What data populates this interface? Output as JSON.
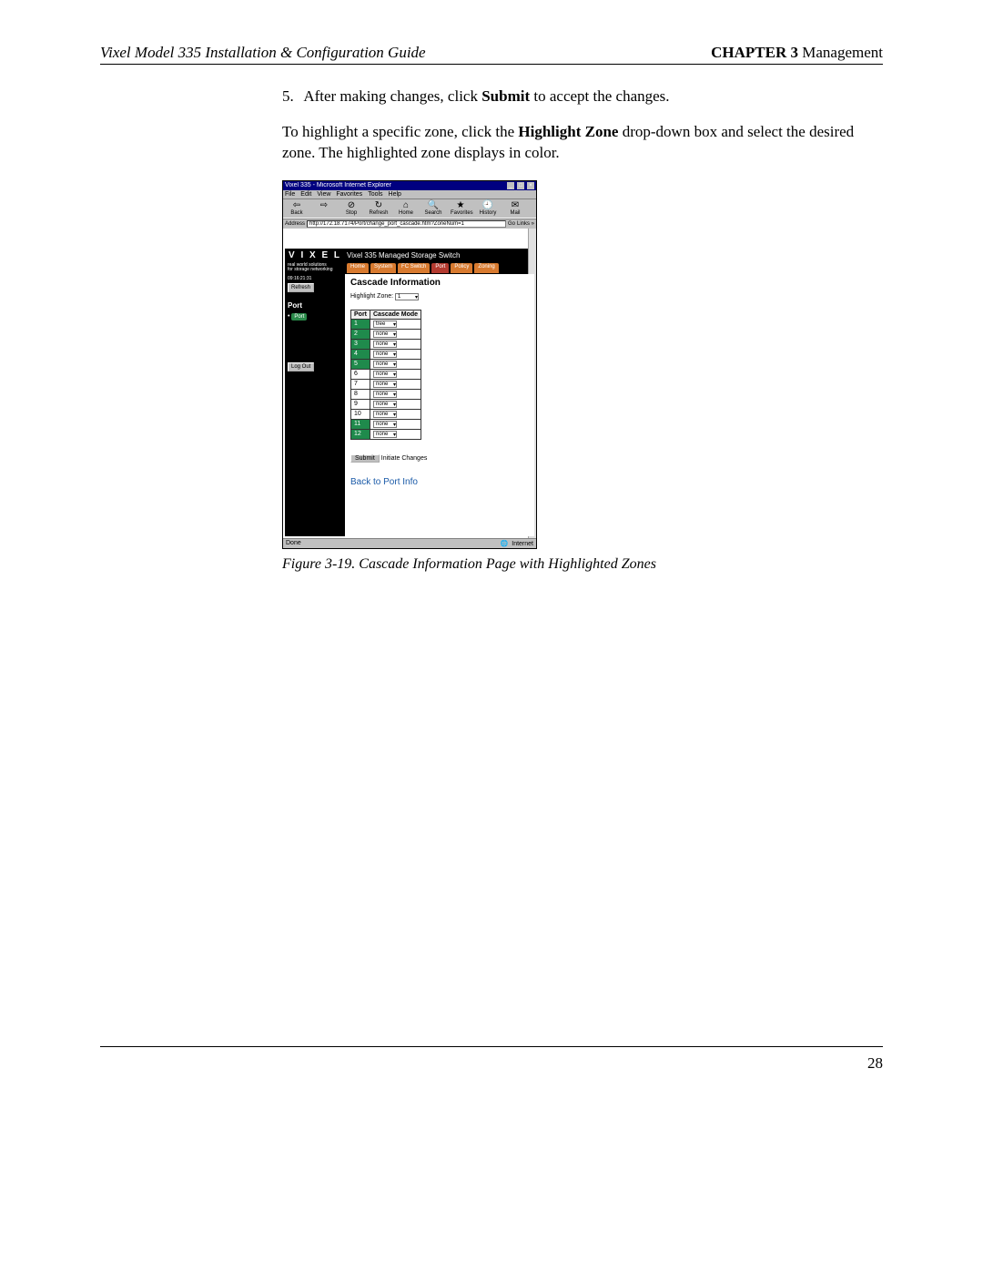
{
  "header": {
    "left": "Vixel Model 335 Installation & Configuration Guide",
    "chapter_label": "CHAPTER 3",
    "chapter_title": " Management"
  },
  "step": {
    "num": "5.",
    "pre": "After making changes, click ",
    "bold": "Submit",
    "post": " to accept the changes."
  },
  "para": {
    "pre": "To highlight a specific zone, click the ",
    "bold": "Highlight Zone",
    "post": " drop-down box and select the desired zone. The highlighted zone displays in color."
  },
  "ie": {
    "title": "Vixel 335 - Microsoft Internet Explorer",
    "menus": [
      "File",
      "Edit",
      "View",
      "Favorites",
      "Tools",
      "Help"
    ],
    "toolbar": [
      {
        "glyph": "⇦",
        "label": "Back"
      },
      {
        "glyph": "⇨",
        "label": ""
      },
      {
        "glyph": "⊘",
        "label": "Stop"
      },
      {
        "glyph": "↻",
        "label": "Refresh"
      },
      {
        "glyph": "⌂",
        "label": "Home"
      },
      {
        "glyph": "🔍",
        "label": "Search"
      },
      {
        "glyph": "★",
        "label": "Favorites"
      },
      {
        "glyph": "🕘",
        "label": "History"
      },
      {
        "glyph": "✉",
        "label": "Mail"
      }
    ],
    "address_label": "Address",
    "address_url": "http://172.18.7174/Port/change_port_cascade.htm?ZoneNum=1",
    "go": "Go",
    "links": "Links »"
  },
  "app": {
    "logo": "V I X E L",
    "brand_sub": "Vixel 335 Managed Storage Switch",
    "tagline1": "real world solutions",
    "tagline2": "for storage networking",
    "tabs": [
      "Home",
      "System",
      "FC Switch",
      "Port",
      "Policy",
      "Zoning"
    ],
    "active_tab_index": 3,
    "sidebar": {
      "time": "09:16:21:31",
      "refresh": "Refresh",
      "section": "Port",
      "subitem": "Port",
      "logout": "Log Out"
    },
    "content": {
      "title": "Cascade Information",
      "highlight_label": "Highlight Zone:",
      "highlight_value": "1",
      "table_headers": [
        "Port",
        "Cascade Mode"
      ],
      "rows": [
        {
          "port": "1",
          "mode": "tree",
          "hl": true
        },
        {
          "port": "2",
          "mode": "none",
          "hl": true
        },
        {
          "port": "3",
          "mode": "none",
          "hl": true
        },
        {
          "port": "4",
          "mode": "none",
          "hl": true
        },
        {
          "port": "5",
          "mode": "none",
          "hl": true
        },
        {
          "port": "6",
          "mode": "none",
          "hl": false
        },
        {
          "port": "7",
          "mode": "none",
          "hl": false
        },
        {
          "port": "8",
          "mode": "none",
          "hl": false
        },
        {
          "port": "9",
          "mode": "none",
          "hl": false
        },
        {
          "port": "10",
          "mode": "none",
          "hl": false
        },
        {
          "port": "11",
          "mode": "none",
          "hl": true
        },
        {
          "port": "12",
          "mode": "none",
          "hl": true
        }
      ],
      "submit": "Submit",
      "submit_hint": "Initiate Changes",
      "backlink": "Back to Port Info"
    }
  },
  "statusbar": {
    "left": "Done",
    "right": "Internet"
  },
  "caption": "Figure 3-19. Cascade Information Page with Highlighted Zones",
  "page_number": "28"
}
